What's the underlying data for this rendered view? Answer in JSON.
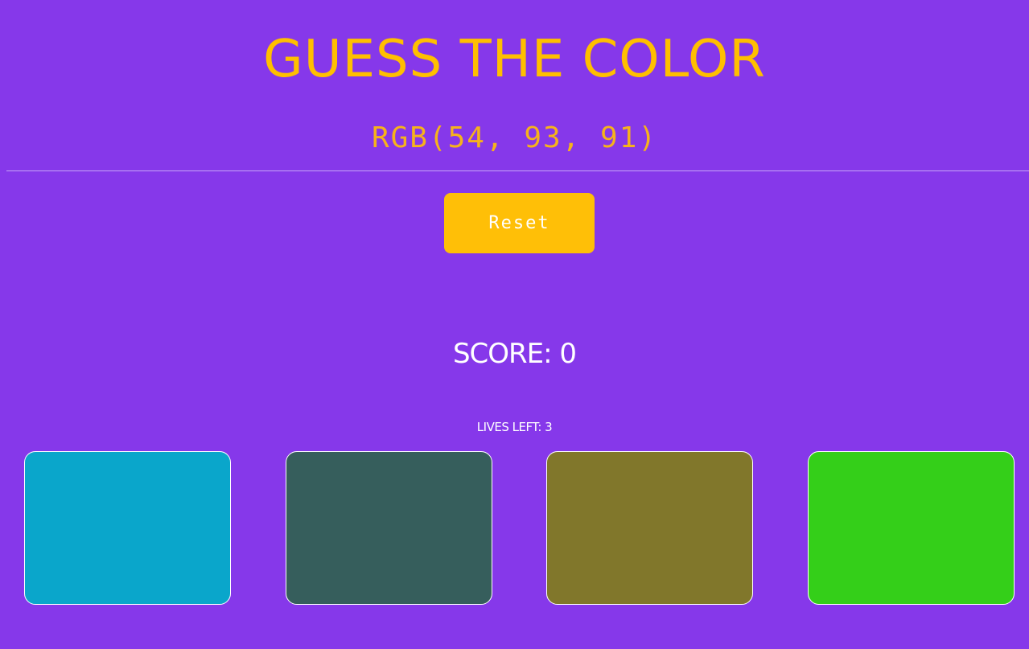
{
  "game": {
    "title": "GUESS THE COLOR",
    "target_rgb": "RGB(54, 93, 91)",
    "reset_label": "Reset",
    "score_text": "SCORE: 0",
    "lives_text": "LIVES LEFT: 3"
  },
  "colors": {
    "background": "#8638ea",
    "title": "#ffbf00",
    "reset_button": "#ffbf07"
  },
  "tiles": [
    {
      "color": "#0aa6cb"
    },
    {
      "color": "#365e5c"
    },
    {
      "color": "#81772b"
    },
    {
      "color": "#34cf19"
    }
  ]
}
